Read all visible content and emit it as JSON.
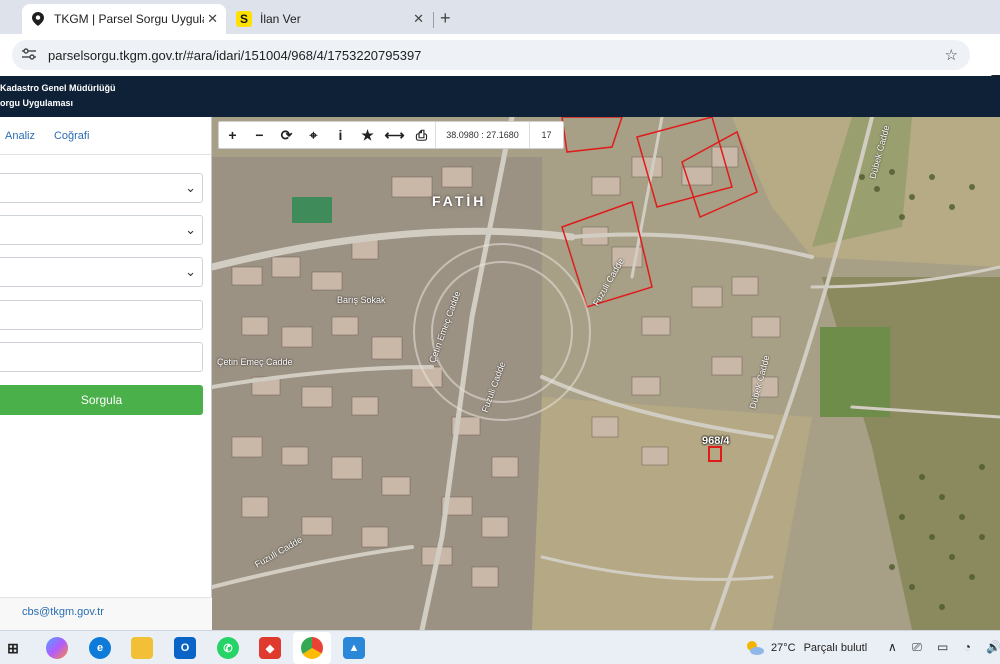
{
  "browser": {
    "tabs": [
      {
        "title": "TKGM | Parsel Sorgu Uygulaması",
        "icon": "location-pin-icon",
        "active": true
      },
      {
        "title": "İlan Ver",
        "icon": "sahibinden-s-icon",
        "active": false
      }
    ],
    "new_tab": "+",
    "url": "parselsorgu.tkgm.gov.tr/#ara/idari/151004/968/4/1753220795397"
  },
  "app": {
    "header_line1": "Kadastro Genel Müdürlüğü",
    "header_line2": "orgu Uygulaması"
  },
  "sidebar": {
    "tabs": [
      "Analiz",
      "Coğrafi"
    ],
    "submit_label": "Sorgula",
    "footer_email": "cbs@tkgm.gov.tr"
  },
  "map": {
    "coordinates": "38.0980 : 27.1680",
    "zoom_level": "17",
    "parcel_label": "968/4",
    "area_label": "FATİH",
    "streets": [
      "Fuzuli Cadde",
      "Çetin Emeç Cadde",
      "Dübek Cadde",
      "Barış Sokak",
      "Çetin Emeç Cadde",
      "Fuzuli Cadde",
      "Dübek Cadde",
      "Fuzuli Cadde"
    ],
    "colors": {
      "parcel_outline": "#e01b1b",
      "selection": "#e01b1b"
    }
  },
  "taskbar": {
    "temperature": "27°C",
    "weather_text": "Parçalı bulutl"
  }
}
